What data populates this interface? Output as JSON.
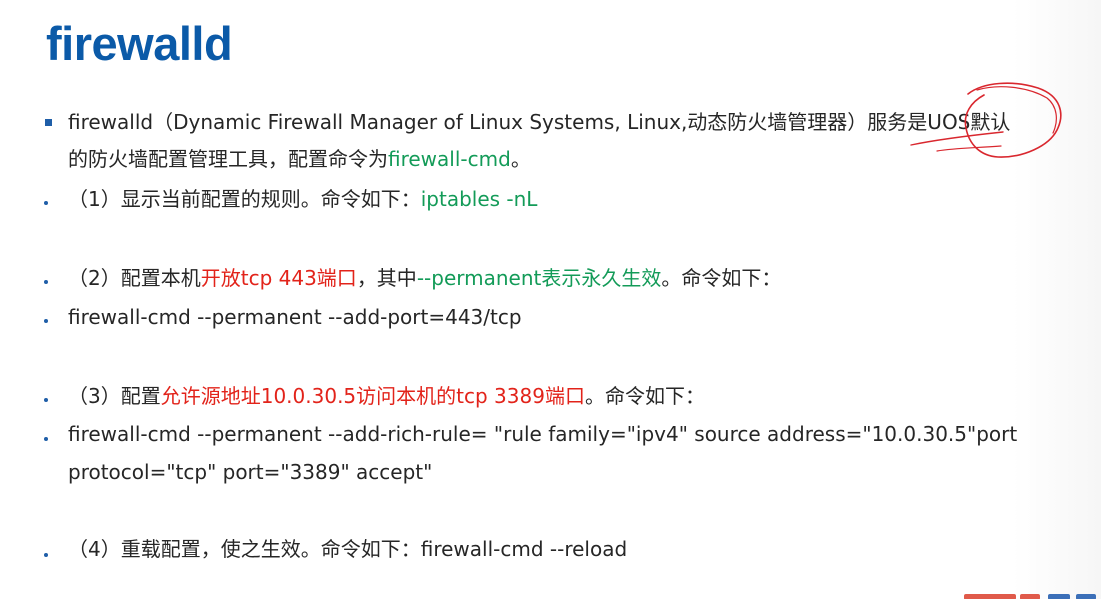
{
  "title": "firewalld",
  "intro": {
    "line1_a": "firewalld（Dynamic Firewall Manager of Linux Systems, Linux,动态防火墙管理器）服务是UOS默认",
    "line2_a": "的防火墙配置管理工具，配置命令为",
    "line2_cmd": "firewall-cmd",
    "line2_end": "。"
  },
  "item1": {
    "text": "（1）显示当前配置的规则。命令如下：",
    "cmd": "iptables -nL"
  },
  "item2": {
    "a": "（2）配置本机",
    "red": "开放tcp 443端口",
    "b": "，其中",
    "green": "--permanent表示永久生效",
    "c": "。命令如下："
  },
  "item2_cmd": "firewall-cmd --permanent --add-port=443/tcp",
  "item3": {
    "a": "（3）配置",
    "red": "允许源地址10.0.30.5访问本机的tcp 3389端口",
    "b": "。命令如下："
  },
  "item3_cmd": {
    "line1": "firewall-cmd --permanent --add-rich-rule= \"rule family=\"ipv4\" source address=\"10.0.30.5\"port",
    "line2": "protocol=\"tcp\" port=\"3389\" accept\""
  },
  "item4": "（4）重载配置，使之生效。命令如下：firewall-cmd --reload",
  "colors": {
    "title": "#0b5aa8",
    "bullet": "#1f5ea8",
    "highlight_green": "#139b58",
    "highlight_red": "#e2231a",
    "annotation": "#d9272e"
  }
}
